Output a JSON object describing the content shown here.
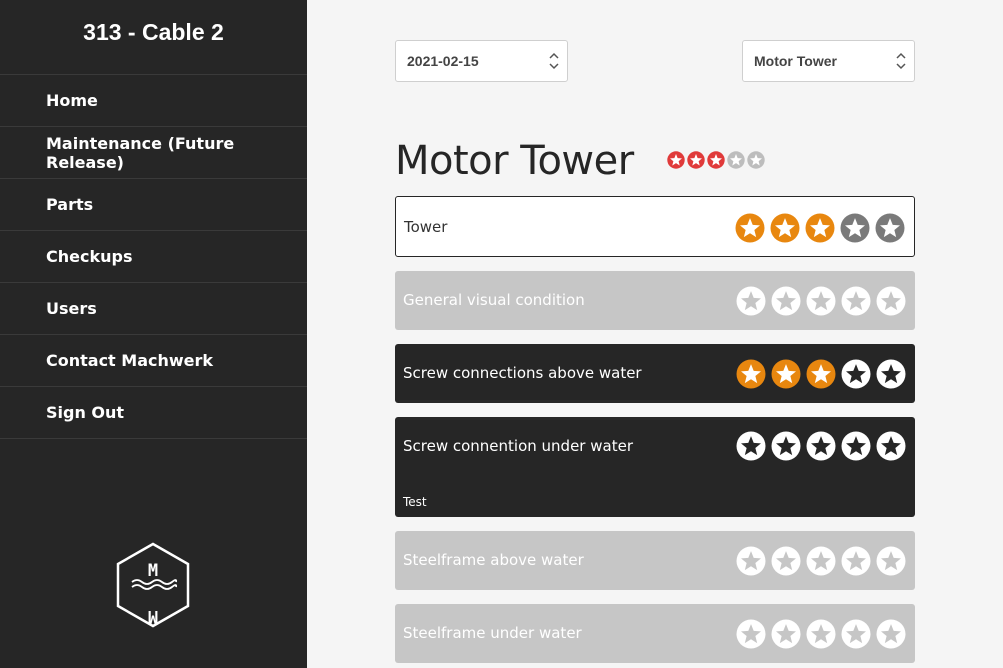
{
  "sidebar": {
    "title": "313 - Cable 2",
    "items": [
      {
        "label": "Home",
        "name": "sidebar-item-home"
      },
      {
        "label": "Maintenance (Future Release)",
        "name": "sidebar-item-maintenance"
      },
      {
        "label": "Parts",
        "name": "sidebar-item-parts"
      },
      {
        "label": "Checkups",
        "name": "sidebar-item-checkups"
      },
      {
        "label": "Users",
        "name": "sidebar-item-users"
      },
      {
        "label": "Contact Machwerk",
        "name": "sidebar-item-contact"
      },
      {
        "label": "Sign Out",
        "name": "sidebar-item-sign-out"
      }
    ],
    "logo": {
      "top_letter": "M",
      "bottom_letter": "M"
    }
  },
  "filters": {
    "date": "2021-02-15",
    "section": "Motor Tower"
  },
  "main": {
    "title": "Motor Tower",
    "title_rating": 3,
    "title_max": 5,
    "items": [
      {
        "label": "Tower",
        "rating": 3,
        "max": 5,
        "style": "white",
        "note": ""
      },
      {
        "label": "General visual condition",
        "rating": 0,
        "max": 5,
        "style": "gray",
        "note": ""
      },
      {
        "label": "Screw connections above water",
        "rating": 3,
        "max": 5,
        "style": "dark",
        "note": ""
      },
      {
        "label": "Screw connention under water",
        "rating": 0,
        "max": 5,
        "style": "dark",
        "note": "Test"
      },
      {
        "label": "Steelframe above water",
        "rating": 0,
        "max": 5,
        "style": "gray",
        "note": ""
      },
      {
        "label": "Steelframe under water",
        "rating": 0,
        "max": 5,
        "style": "gray",
        "note": ""
      }
    ]
  },
  "colors": {
    "sidebar_bg": "#262626",
    "star_active": "#e8870f",
    "star_inactive_white_card": "#7a7a7a",
    "title_star_active": "#e03a3a",
    "title_star_inactive": "#bdbdbd"
  },
  "icons": {
    "select_chevron": "chevron-up-down-icon",
    "rating_star": "star-icon",
    "logo": "machwerk-hexagon-logo"
  }
}
